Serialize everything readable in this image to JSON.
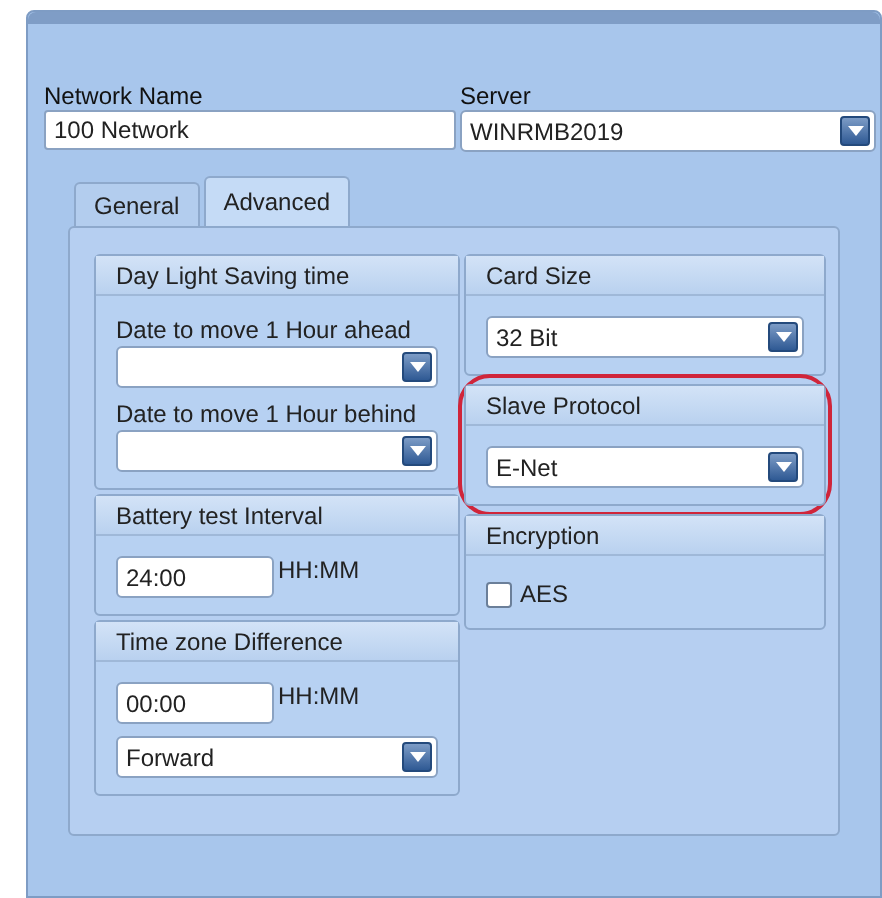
{
  "network_name": {
    "label": "Network Name",
    "value": "100 Network"
  },
  "server": {
    "label": "Server",
    "value": "WINRMB2019"
  },
  "tabs": [
    {
      "label": "General",
      "selected": false
    },
    {
      "label": "Advanced",
      "selected": true
    }
  ],
  "left_groups": [
    {
      "title": "Day Light Saving time",
      "highlighted": false,
      "fields": [
        {
          "kind": "dropdown",
          "label": "Date to move 1 Hour ahead"
        },
        {
          "kind": "dropdown",
          "label": "Date to move 1 Hour behind"
        }
      ]
    },
    {
      "title": "Battery test Interval",
      "highlighted": false,
      "fields": [
        {
          "kind": "time",
          "value": "24:00",
          "unit": "HH:MM"
        }
      ]
    },
    {
      "title": "Time zone Difference",
      "highlighted": false,
      "fields": [
        {
          "kind": "time",
          "value": "00:00",
          "unit": "HH:MM"
        },
        {
          "kind": "dropdown",
          "value": "Forward"
        }
      ]
    }
  ],
  "right_groups": [
    {
      "title": "Card Size",
      "highlighted": false,
      "fields": [
        {
          "kind": "dropdown",
          "value": "32 Bit"
        }
      ]
    },
    {
      "title": "Slave Protocol",
      "highlighted": true,
      "fields": [
        {
          "kind": "dropdown",
          "value": "E-Net"
        }
      ]
    },
    {
      "title": "Encryption",
      "highlighted": false,
      "fields": [
        {
          "kind": "checkbox",
          "label": "AES",
          "checked": false
        }
      ]
    }
  ]
}
